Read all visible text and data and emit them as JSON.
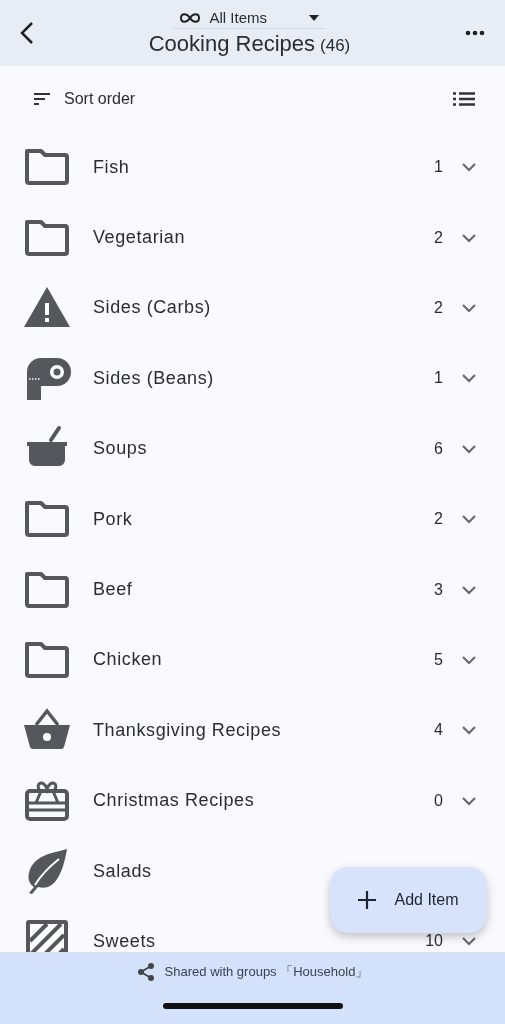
{
  "header": {
    "filter": "All Items",
    "title": "Cooking Recipes",
    "count": "(46)"
  },
  "toolbar": {
    "sort_label": "Sort order"
  },
  "categories": [
    {
      "kind": "folder",
      "name": "Fish",
      "count": "1"
    },
    {
      "kind": "folder",
      "name": "Vegetarian",
      "count": "2"
    },
    {
      "kind": "warning",
      "name": "Sides (Carbs)",
      "count": "2"
    },
    {
      "kind": "roll",
      "name": "Sides (Beans)",
      "count": "1"
    },
    {
      "kind": "pot",
      "name": "Soups",
      "count": "6"
    },
    {
      "kind": "folder",
      "name": "Pork",
      "count": "2"
    },
    {
      "kind": "folder",
      "name": "Beef",
      "count": "3"
    },
    {
      "kind": "folder",
      "name": "Chicken",
      "count": "5"
    },
    {
      "kind": "basket",
      "name": "Thanksgiving Recipes",
      "count": "4"
    },
    {
      "kind": "gift",
      "name": "Christmas Recipes",
      "count": "0"
    },
    {
      "kind": "leaf",
      "name": "Salads"
    },
    {
      "kind": "stripes",
      "name": "Sweets",
      "count": "10"
    }
  ],
  "fab": {
    "label": "Add Item"
  },
  "footer": {
    "shared": "Shared with groups 「Household」"
  }
}
